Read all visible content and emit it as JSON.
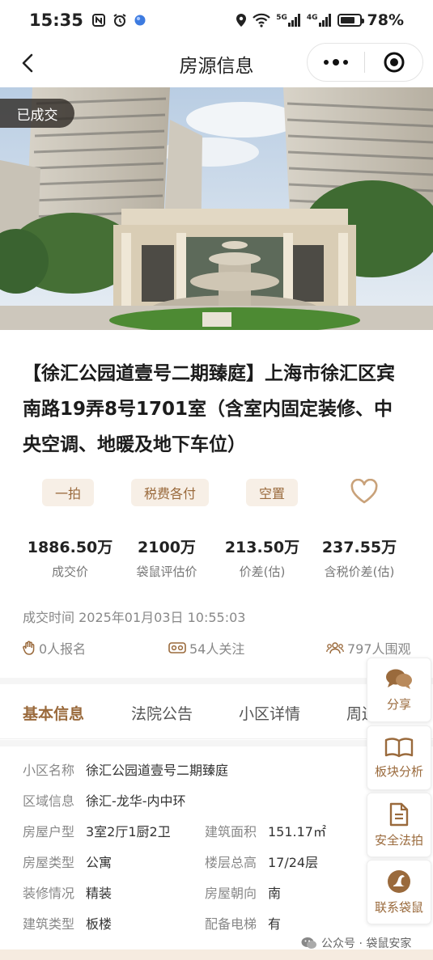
{
  "status_bar": {
    "time": "15:35",
    "battery": "78%",
    "battery_level": 0.78,
    "network_a": "5G",
    "network_b": "4G"
  },
  "nav": {
    "title": "房源信息"
  },
  "hero": {
    "badge": "已成交"
  },
  "listing": {
    "title": "【徐汇公园道壹号二期臻庭】上海市徐汇区宾南路19弄8号1701室（含室内固定装修、中央空调、地暖及地下车位）"
  },
  "tags": [
    "一拍",
    "税费各付",
    "空置"
  ],
  "stats": [
    {
      "value": "1886.50万",
      "label": "成交价"
    },
    {
      "value": "2100万",
      "label": "袋鼠评估价"
    },
    {
      "value": "213.50万",
      "label": "价差(估)"
    },
    {
      "value": "237.55万",
      "label": "含税价差(估)"
    }
  ],
  "deal_time": "成交时间 2025年01月03日 10:55:03",
  "metrics": {
    "signups": "0人报名",
    "follows": "54人关注",
    "views": "797人围观"
  },
  "tabs": [
    "基本信息",
    "法院公告",
    "小区详情",
    "周边"
  ],
  "info": {
    "community_label": "小区名称",
    "community_value": "徐汇公园道壹号二期臻庭",
    "area_label": "区域信息",
    "area_value": "徐汇-龙华-内中环",
    "rows": [
      {
        "l1": "房屋户型",
        "v1": "3室2厅1厨2卫",
        "l2": "建筑面积",
        "v2": "151.17㎡"
      },
      {
        "l1": "房屋类型",
        "v1": "公寓",
        "l2": "楼层总高",
        "v2": "17/24层"
      },
      {
        "l1": "装修情况",
        "v1": "精装",
        "l2": "房屋朝向",
        "v2": "南"
      },
      {
        "l1": "建筑类型",
        "v1": "板楼",
        "l2": "配备电梯",
        "v2": "有"
      }
    ]
  },
  "side_buttons": {
    "share": "分享",
    "district": "板块分析",
    "safe": "安全法拍",
    "contact": "联系袋鼠"
  },
  "watermark": "公众号 · 袋鼠安家",
  "colors": {
    "accent": "#9a6a3c",
    "tag_bg": "#f7efe6",
    "heart": "#c9a27a"
  }
}
